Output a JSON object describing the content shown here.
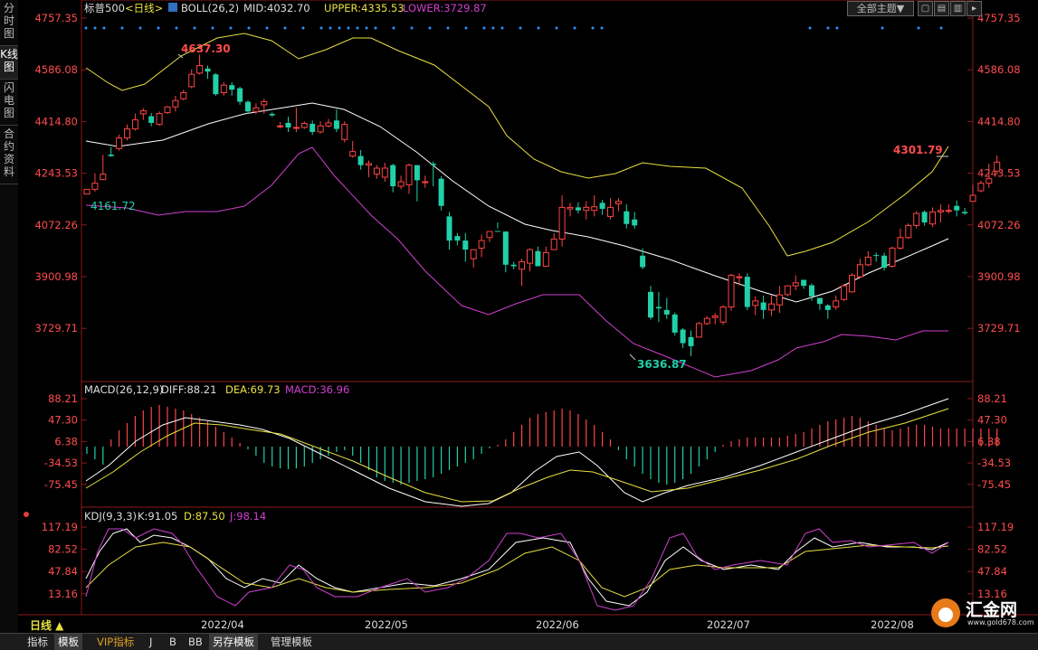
{
  "sidebar": {
    "tabs": [
      "分时图",
      "K线图",
      "闪电图",
      "合约资料"
    ],
    "active_index": 1
  },
  "main_header": {
    "symbol": "标普500",
    "period_tag": "<日线>",
    "indicator": "BOLL(26,2)",
    "mid": "MID:4032.70",
    "upper": "UPPER:4335.53",
    "lower": "LOWER:3729.87"
  },
  "toolbar": {
    "theme_button": "全部主题▼",
    "buttons": [
      "icon-a",
      "icon-b",
      "icon-c",
      "icon-d"
    ]
  },
  "price_axis": {
    "ticks": [
      "4757.35",
      "4586.08",
      "4414.80",
      "4243.53",
      "4072.26",
      "3900.98",
      "3729.71"
    ]
  },
  "annotations": {
    "high": "4637.30",
    "start_low": "4161.72",
    "low": "3636.87",
    "recent_high": "4301.79"
  },
  "macd_header": {
    "name": "MACD(26,12,9)",
    "diff": "DIFF:88.21",
    "dea": "DEA:69.73",
    "macd": "MACD:36.96"
  },
  "macd_axis": {
    "ticks": [
      "88.21",
      "47.30",
      "6.38",
      "-34.53",
      "-75.45"
    ]
  },
  "kdj_header": {
    "name": "KDJ(9,3,3)",
    "k": "K:91.05",
    "d": "D:87.50",
    "j": "J:98.14"
  },
  "kdj_axis": {
    "ticks": [
      "117.19",
      "82.52",
      "47.84",
      "13.16"
    ]
  },
  "date_axis": {
    "period_label": "日线 ▲",
    "months": [
      "2022/04",
      "2022/05",
      "2022/06",
      "2022/07",
      "2022/08"
    ]
  },
  "bottom_tabs": [
    "指标",
    "模板",
    "VIP指标",
    "J",
    "B",
    "BB",
    "另存模板",
    "管理模板"
  ],
  "logo": {
    "name": "汇金网",
    "site": "www.gold678.com"
  },
  "colors": {
    "up": "#ff4444",
    "down": "#21d0a8",
    "mid": "#ffffff",
    "upper": "#e8e040",
    "lower": "#d040d0",
    "axis_text": "#ff4d4d",
    "header_dea": "#e8e040",
    "header_macd": "#d040d0",
    "dots": "#3090ff"
  },
  "chart_data": {
    "type": "candlestick",
    "price_range": [
      3650,
      4790
    ],
    "candles": [
      [
        4174,
        4190,
        4162,
        4161
      ],
      [
        4190,
        4210,
        4243,
        4182
      ],
      [
        4222,
        4240,
        4304,
        4220
      ],
      [
        4305,
        4300,
        4330,
        4298
      ],
      [
        4325,
        4360,
        4371,
        4318
      ],
      [
        4360,
        4390,
        4405,
        4352
      ],
      [
        4390,
        4420,
        4441,
        4385
      ],
      [
        4440,
        4450,
        4459,
        4420
      ],
      [
        4432,
        4410,
        4443,
        4399
      ],
      [
        4405,
        4441,
        4448,
        4400
      ],
      [
        4444,
        4463,
        4466,
        4440
      ],
      [
        4463,
        4484,
        4500,
        4448
      ],
      [
        4490,
        4510,
        4520,
        4485
      ],
      [
        4530,
        4571,
        4587,
        4525
      ],
      [
        4575,
        4600,
        4637,
        4570
      ],
      [
        4590,
        4580,
        4600,
        4556
      ],
      [
        4571,
        4505,
        4575,
        4500
      ],
      [
        4510,
        4535,
        4545,
        4500
      ],
      [
        4535,
        4520,
        4545,
        4500
      ],
      [
        4525,
        4480,
        4530,
        4470
      ],
      [
        4480,
        4448,
        4485,
        4440
      ],
      [
        4447,
        4460,
        4475,
        4440
      ],
      [
        4470,
        4480,
        4490,
        4440
      ],
      [
        4440,
        4435,
        4445,
        4430
      ],
      [
        4400,
        4400,
        4413,
        4392
      ],
      [
        4410,
        4395,
        4430,
        4380
      ],
      [
        4395,
        4395,
        4460,
        4380
      ],
      [
        4395,
        4408,
        4415,
        4390
      ],
      [
        4407,
        4380,
        4418,
        4370
      ],
      [
        4380,
        4400,
        4415,
        4375
      ],
      [
        4400,
        4410,
        4423,
        4395
      ],
      [
        4418,
        4390,
        4455,
        4380
      ],
      [
        4355,
        4405,
        4415,
        4345
      ],
      [
        4300,
        4315,
        4350,
        4295
      ],
      [
        4300,
        4270,
        4320,
        4255
      ],
      [
        4270,
        4275,
        4285,
        4230
      ],
      [
        4240,
        4260,
        4270,
        4225
      ],
      [
        4230,
        4260,
        4278,
        4215
      ],
      [
        4270,
        4200,
        4275,
        4180
      ],
      [
        4200,
        4215,
        4235,
        4190
      ],
      [
        4205,
        4270,
        4275,
        4175
      ],
      [
        4270,
        4220,
        4270,
        4150
      ],
      [
        4215,
        4215,
        4235,
        4195
      ],
      [
        4275,
        4270,
        4282,
        4200
      ],
      [
        4225,
        4135,
        4234,
        4120
      ],
      [
        4100,
        4020,
        4115,
        3990
      ],
      [
        4035,
        4020,
        4045,
        4004
      ],
      [
        4020,
        3990,
        4045,
        3950
      ],
      [
        3960,
        3990,
        3988,
        3930
      ],
      [
        3995,
        4020,
        4040,
        3965
      ],
      [
        4030,
        4050,
        4045,
        4015
      ],
      [
        4052,
        4050,
        4080,
        4060
      ],
      [
        4050,
        3940,
        4050,
        3915
      ],
      [
        3940,
        3935,
        3950,
        3925
      ],
      [
        3925,
        3950,
        3960,
        3870
      ],
      [
        3945,
        3990,
        3995,
        3918
      ],
      [
        3985,
        3935,
        4000,
        3935
      ],
      [
        3935,
        3980,
        4000,
        3935
      ],
      [
        3990,
        4025,
        4045,
        3990
      ],
      [
        4025,
        4130,
        4170,
        4000
      ],
      [
        4125,
        4130,
        4145,
        4100
      ],
      [
        4130,
        4120,
        4147,
        4110
      ],
      [
        4120,
        4130,
        4150,
        4090
      ],
      [
        4120,
        4132,
        4170,
        4100
      ],
      [
        4145,
        4125,
        4155,
        4105
      ],
      [
        4100,
        4130,
        4160,
        4090
      ],
      [
        4142,
        4150,
        4160,
        4117
      ],
      [
        4117,
        4075,
        4140,
        4060
      ],
      [
        4090,
        4070,
        4115,
        4060
      ],
      [
        3970,
        3932,
        3995,
        3925
      ],
      [
        3850,
        3765,
        3870,
        3758
      ],
      [
        3800,
        3795,
        3850,
        3750
      ],
      [
        3790,
        3775,
        3830,
        3760
      ],
      [
        3775,
        3715,
        3782,
        3705
      ],
      [
        3725,
        3680,
        3730,
        3664
      ],
      [
        3700,
        3670,
        3722,
        3637
      ],
      [
        3700,
        3745,
        3750,
        3700
      ],
      [
        3745,
        3762,
        3770,
        3740
      ],
      [
        3765,
        3770,
        3780,
        3742
      ],
      [
        3750,
        3800,
        3805,
        3740
      ],
      [
        3800,
        3905,
        3910,
        3788
      ],
      [
        3900,
        3900,
        3912,
        3872
      ],
      [
        3900,
        3800,
        3912,
        3790
      ],
      [
        3805,
        3820,
        3835,
        3773
      ],
      [
        3815,
        3790,
        3838,
        3760
      ],
      [
        3790,
        3810,
        3840,
        3770
      ],
      [
        3807,
        3840,
        3870,
        3780
      ],
      [
        3841,
        3870,
        3870,
        3835
      ],
      [
        3870,
        3880,
        3905,
        3855
      ],
      [
        3890,
        3870,
        3890,
        3860
      ],
      [
        3872,
        3835,
        3878,
        3820
      ],
      [
        3830,
        3810,
        3830,
        3790
      ],
      [
        3805,
        3790,
        3810,
        3761
      ],
      [
        3800,
        3820,
        3838,
        3790
      ],
      [
        3825,
        3870,
        3877,
        3820
      ],
      [
        3850,
        3905,
        3912,
        3848
      ],
      [
        3900,
        3940,
        3960,
        3895
      ],
      [
        3940,
        3965,
        3985,
        3935
      ],
      [
        3972,
        3970,
        3980,
        3950
      ],
      [
        3970,
        3930,
        3980,
        3920
      ],
      [
        3935,
        3995,
        4000,
        3930
      ],
      [
        3995,
        4030,
        4060,
        3990
      ],
      [
        4030,
        4070,
        4077,
        4025
      ],
      [
        4070,
        4110,
        4118,
        4060
      ],
      [
        4115,
        4080,
        4120,
        4070
      ],
      [
        4075,
        4115,
        4130,
        4065
      ],
      [
        4115,
        4120,
        4140,
        4080
      ],
      [
        4120,
        4120,
        4140,
        4110
      ],
      [
        4135,
        4120,
        4153,
        4100
      ],
      [
        4115,
        4110,
        4128,
        4105
      ],
      [
        4150,
        4170,
        4205,
        4148
      ],
      [
        4185,
        4210,
        4218,
        4180
      ],
      [
        4210,
        4225,
        4275,
        4195
      ],
      [
        4250,
        4280,
        4302,
        4240
      ]
    ],
    "series_names": [
      "MID",
      "UPPER",
      "LOWER",
      "DIFF",
      "DEA",
      "MACD",
      "K",
      "D",
      "J"
    ]
  }
}
